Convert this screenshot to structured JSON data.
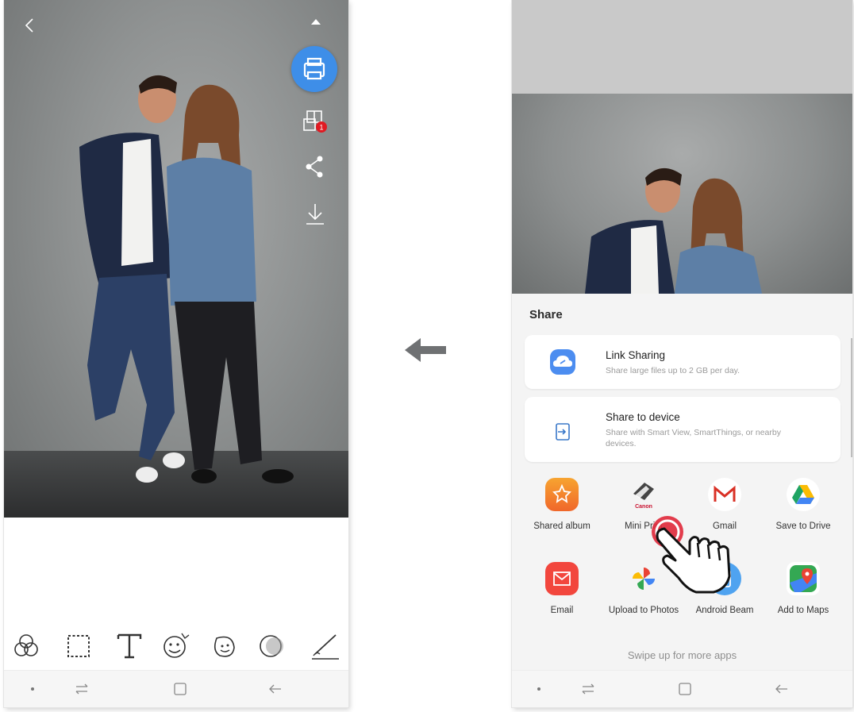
{
  "share": {
    "title": "Share",
    "link_sharing": {
      "title": "Link Sharing",
      "description": "Share large files up to 2 GB per day."
    },
    "share_to_device": {
      "title": "Share to device",
      "description": "Share with Smart View, SmartThings, or nearby devices."
    },
    "apps": [
      {
        "label": "Shared album",
        "icon": "shared-album-icon"
      },
      {
        "label": "Mini Print",
        "icon": "canon-mini-print-icon"
      },
      {
        "label": "Gmail",
        "icon": "gmail-icon"
      },
      {
        "label": "Save to Drive",
        "icon": "google-drive-icon"
      },
      {
        "label": "Email",
        "icon": "email-icon"
      },
      {
        "label": "Upload to Photos",
        "icon": "google-photos-icon"
      },
      {
        "label": "Android Beam",
        "icon": "android-beam-icon"
      },
      {
        "label": "Add to Maps",
        "icon": "google-maps-icon"
      }
    ],
    "swipe_hint": "Swipe up for more apps"
  },
  "left_notification_count": "1",
  "canon_brand": "Canon",
  "colors": {
    "print_button": "#3e8ee8",
    "badge": "#e01a22",
    "touch_indicator": "#e0283a",
    "cloud_icon": "#4c8df0"
  }
}
